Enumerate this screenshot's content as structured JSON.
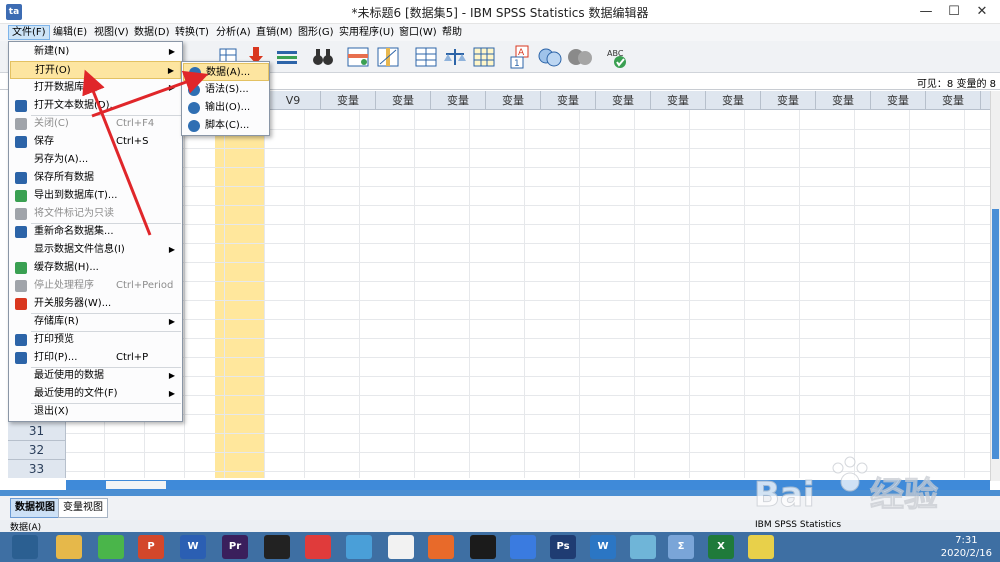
{
  "window": {
    "title": "*未标题6 [数据集5] - IBM SPSS Statistics 数据编辑器",
    "icon": "spss-app-icon",
    "controls": [
      "minimize-icon",
      "maximize-icon",
      "close-icon"
    ]
  },
  "menubar": {
    "items": [
      "文件(F)",
      "编辑(E)",
      "视图(V)",
      "数据(D)",
      "转换(T)",
      "分析(A)",
      "直销(M)",
      "图形(G)",
      "实用程序(U)",
      "窗口(W)",
      "帮助"
    ]
  },
  "toolbar": {
    "icons": [
      "open-data-icon",
      "import-icon",
      "variables-icon",
      "find-binoculars-icon",
      "insert-cases-icon",
      "insert-variable-icon",
      "split-file-icon",
      "weight-cases-icon",
      "select-cases-icon",
      "value-labels-icon",
      "use-sets-icon",
      "show-sets-icon",
      "spell-check-icon"
    ],
    "spell_label": "ABC"
  },
  "visible_bar": {
    "text": "可见：8 变量的 8"
  },
  "grid": {
    "headers": [
      "V9",
      "变量",
      "变量",
      "变量",
      "变量",
      "变量",
      "变量",
      "变量",
      "变量",
      "变量",
      "变量",
      "变量",
      "变量",
      "变量"
    ],
    "row_numbers": [
      "30",
      "31",
      "32",
      "33"
    ],
    "selected_column_color": "#ffe79c"
  },
  "file_menu": {
    "items": [
      {
        "label": "新建(N)",
        "shortcut": "",
        "arrow": true,
        "icon": "",
        "disabled": false
      },
      {
        "label": "打开(O)",
        "shortcut": "",
        "arrow": true,
        "icon": "",
        "disabled": false,
        "highlighted": true
      },
      {
        "label": "打开数据库(B)",
        "shortcut": "",
        "arrow": true,
        "icon": "",
        "disabled": false
      },
      {
        "label": "打开文本数据(D)...",
        "shortcut": "",
        "arrow": false,
        "icon": "text-data-icon",
        "disabled": false
      },
      {
        "label": "关闭(C)",
        "shortcut": "Ctrl+F4",
        "arrow": false,
        "icon": "close-file-icon",
        "disabled": true
      },
      {
        "label": "保存",
        "shortcut": "Ctrl+S",
        "arrow": false,
        "icon": "save-icon",
        "disabled": false
      },
      {
        "label": "另存为(A)...",
        "shortcut": "",
        "arrow": false,
        "icon": "",
        "disabled": false
      },
      {
        "label": "保存所有数据",
        "shortcut": "",
        "arrow": false,
        "icon": "save-all-icon",
        "disabled": false
      },
      {
        "label": "导出到数据库(T)...",
        "shortcut": "",
        "arrow": false,
        "icon": "export-db-icon",
        "disabled": false
      },
      {
        "label": "将文件标记为只读",
        "shortcut": "",
        "arrow": false,
        "icon": "readonly-icon",
        "disabled": true
      },
      {
        "label": "重新命名数据集...",
        "shortcut": "",
        "arrow": false,
        "icon": "rename-dataset-icon",
        "disabled": false
      },
      {
        "label": "显示数据文件信息(I)",
        "shortcut": "",
        "arrow": true,
        "icon": "",
        "disabled": false
      },
      {
        "label": "缓存数据(H)...",
        "shortcut": "",
        "arrow": false,
        "icon": "cache-data-icon",
        "disabled": false
      },
      {
        "label": "停止处理程序",
        "shortcut": "Ctrl+Period",
        "arrow": false,
        "icon": "stop-processor-icon",
        "disabled": true
      },
      {
        "label": "开关服务器(W)...",
        "shortcut": "",
        "arrow": false,
        "icon": "switch-server-icon",
        "disabled": false
      },
      {
        "label": "存储库(R)",
        "shortcut": "",
        "arrow": true,
        "icon": "",
        "disabled": false
      },
      {
        "label": "打印预览",
        "shortcut": "",
        "arrow": false,
        "icon": "print-preview-icon",
        "disabled": false
      },
      {
        "label": "打印(P)...",
        "shortcut": "Ctrl+P",
        "arrow": false,
        "icon": "print-icon",
        "disabled": false
      },
      {
        "label": "最近使用的数据",
        "shortcut": "",
        "arrow": true,
        "icon": "",
        "disabled": false
      },
      {
        "label": "最近使用的文件(F)",
        "shortcut": "",
        "arrow": true,
        "icon": "",
        "disabled": false
      },
      {
        "label": "退出(X)",
        "shortcut": "",
        "arrow": false,
        "icon": "",
        "disabled": false
      }
    ]
  },
  "open_submenu": {
    "items": [
      {
        "label": "数据(A)...",
        "icon": "data-icon",
        "highlighted": true
      },
      {
        "label": "语法(S)...",
        "icon": "syntax-icon",
        "highlighted": false
      },
      {
        "label": "输出(O)...",
        "icon": "output-icon",
        "highlighted": false
      },
      {
        "label": "脚本(C)...",
        "icon": "script-icon",
        "highlighted": false
      }
    ]
  },
  "view_tabs": {
    "data_view": "数据视图",
    "variable_view": "变量视图"
  },
  "statusbar": {
    "left": "数据(A)",
    "right": "IBM SPSS Statistics"
  },
  "taskbar": {
    "icons": [
      "start-icon",
      "file-explorer-icon",
      "wechat-icon",
      "powerpoint-icon",
      "word-icon",
      "premiere-icon",
      "video-editor-icon",
      "wps-icon",
      "qq-browser-icon",
      "chrome-icon",
      "foxmail-icon",
      "qq-icon",
      "feishu-icon",
      "photoshop-icon",
      "wps-writer-icon",
      "notes-icon",
      "spss-sigma-icon",
      "excel-icon",
      "clipboard-icon"
    ],
    "labels": [
      "",
      "",
      "",
      "P",
      "W",
      "Pr",
      "",
      "",
      "",
      "",
      "",
      "",
      "",
      "Ps",
      "W",
      "",
      "Σ",
      "X",
      ""
    ],
    "time": "7:31",
    "date": "2020/2/16"
  },
  "colors": {
    "accent": "#3f8ad9",
    "highlight": "#fde5a0",
    "arrow": "#e0262a"
  }
}
